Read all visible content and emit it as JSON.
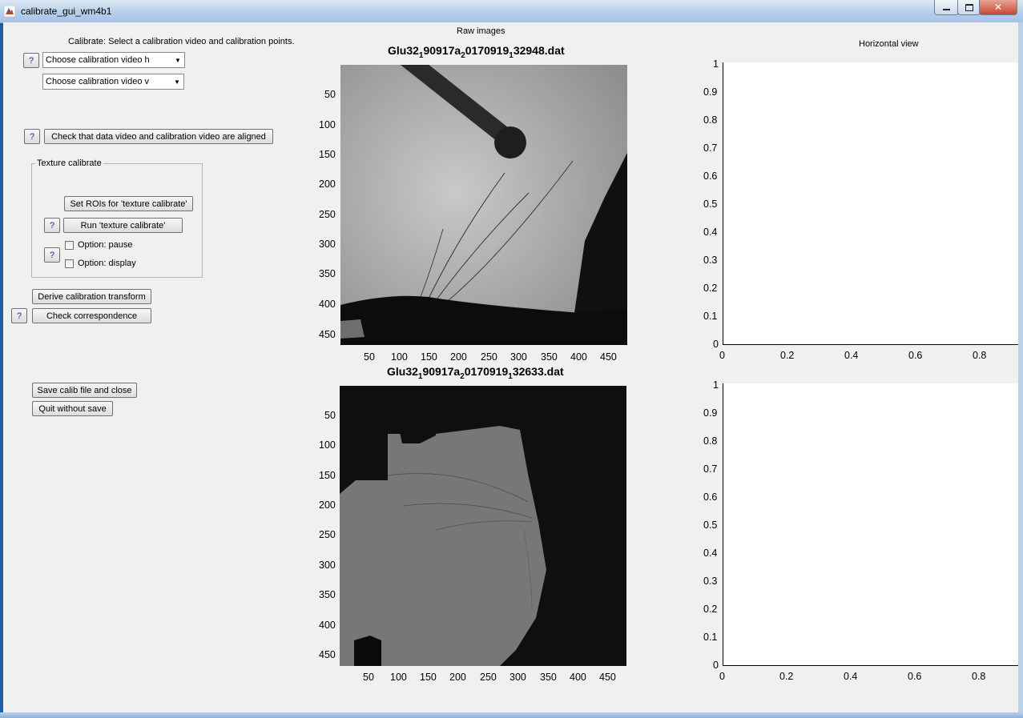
{
  "window": {
    "title": "calibrate_gui_wm4b1",
    "icon": "matlab-icon",
    "controls": [
      "minimize-icon",
      "maximize-icon",
      "close-icon"
    ]
  },
  "left_panel": {
    "instruction": "Calibrate: Select a calibration video and calibration points.",
    "help_label": "?",
    "video_h_select": "Choose calibration video h",
    "video_v_select": "Choose calibration video v",
    "check_aligned_button": "Check that data video and calibration video are aligned",
    "texture_group": {
      "title": "Texture calibrate",
      "set_rois_button": "Set ROIs for 'texture calibrate'",
      "run_button": "Run 'texture calibrate'",
      "option_pause": "Option: pause",
      "option_display": "Option: display"
    },
    "derive_button": "Derive calibration transform",
    "check_correspondence_button": "Check correspondence",
    "save_button": "Save calib file and close",
    "quit_button": "Quit without save"
  },
  "raw_images": {
    "heading": "Raw images",
    "top": {
      "title_parts": [
        "Glu32",
        "1",
        "90917a",
        "2",
        "0170919",
        "1",
        "32948.dat"
      ],
      "y_ticks": [
        "50",
        "100",
        "150",
        "200",
        "250",
        "300",
        "350",
        "400",
        "450"
      ],
      "x_ticks": [
        "50",
        "100",
        "150",
        "200",
        "250",
        "300",
        "350",
        "400",
        "450"
      ]
    },
    "bottom": {
      "title_parts": [
        "Glu32",
        "1",
        "90917a",
        "2",
        "0170919",
        "1",
        "32633.dat"
      ],
      "y_ticks": [
        "50",
        "100",
        "150",
        "200",
        "250",
        "300",
        "350",
        "400",
        "450"
      ],
      "x_ticks": [
        "50",
        "100",
        "150",
        "200",
        "250",
        "300",
        "350",
        "400",
        "450"
      ]
    }
  },
  "horizontal_view": {
    "heading": "Horizontal view",
    "top": {
      "y_ticks": [
        "1",
        "0.9",
        "0.8",
        "0.7",
        "0.6",
        "0.5",
        "0.4",
        "0.3",
        "0.2",
        "0.1",
        "0"
      ],
      "x_ticks": [
        "0",
        "0.2",
        "0.4",
        "0.6",
        "0.8"
      ]
    },
    "bottom": {
      "y_ticks": [
        "1",
        "0.9",
        "0.8",
        "0.7",
        "0.6",
        "0.5",
        "0.4",
        "0.3",
        "0.2",
        "0.1",
        "0"
      ],
      "x_ticks": [
        "0",
        "0.2",
        "0.4",
        "0.6",
        "0.8"
      ]
    }
  }
}
